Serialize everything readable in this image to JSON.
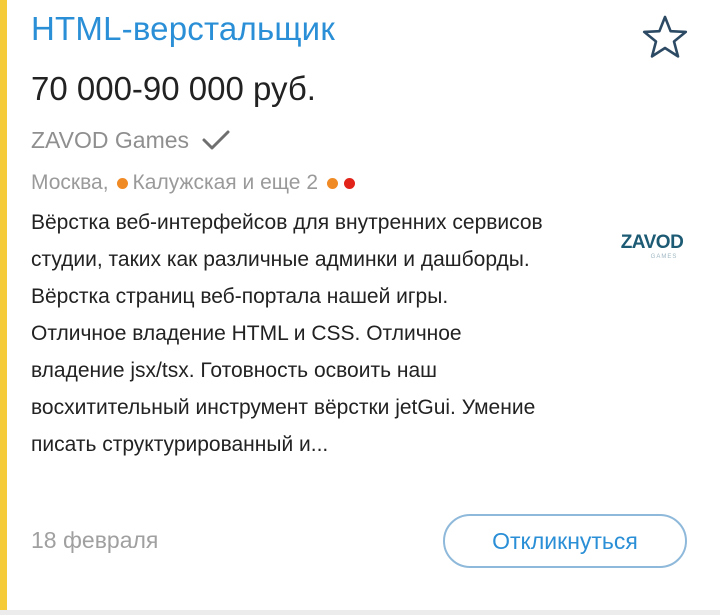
{
  "vacancy": {
    "title": "HTML-верстальщик",
    "salary": "70 000-90 000 руб.",
    "company": "ZAVOD Games",
    "location": {
      "city": "Москва,",
      "metro": "Калужская и еще 2"
    },
    "description": [
      "Вёрстка веб-интерфейсов для внутренних сервисов студии, таких как различные админки и дашборды. Вёрстка страниц веб-портала нашей игры.",
      "Отличное владение HTML и CSS. Отличное владение jsx/tsx. Готовность освоить наш восхитительный инструмент вёрстки jetGui. Умение писать структурированный и..."
    ],
    "logo": {
      "main": "ZAVOD",
      "sub": "GAMES"
    },
    "date": "18 февраля",
    "respond_label": "Откликнуться"
  },
  "colors": {
    "accent_bar": "#f6cb3a",
    "title": "#2a8fd6",
    "metro_orange": "#f08a24",
    "metro_red": "#e2231a",
    "logo_teal": "#1d5b74",
    "button_border": "#8fb9da"
  },
  "icons": {
    "favorite": "star-outline-icon",
    "verified": "checkmark-icon"
  }
}
